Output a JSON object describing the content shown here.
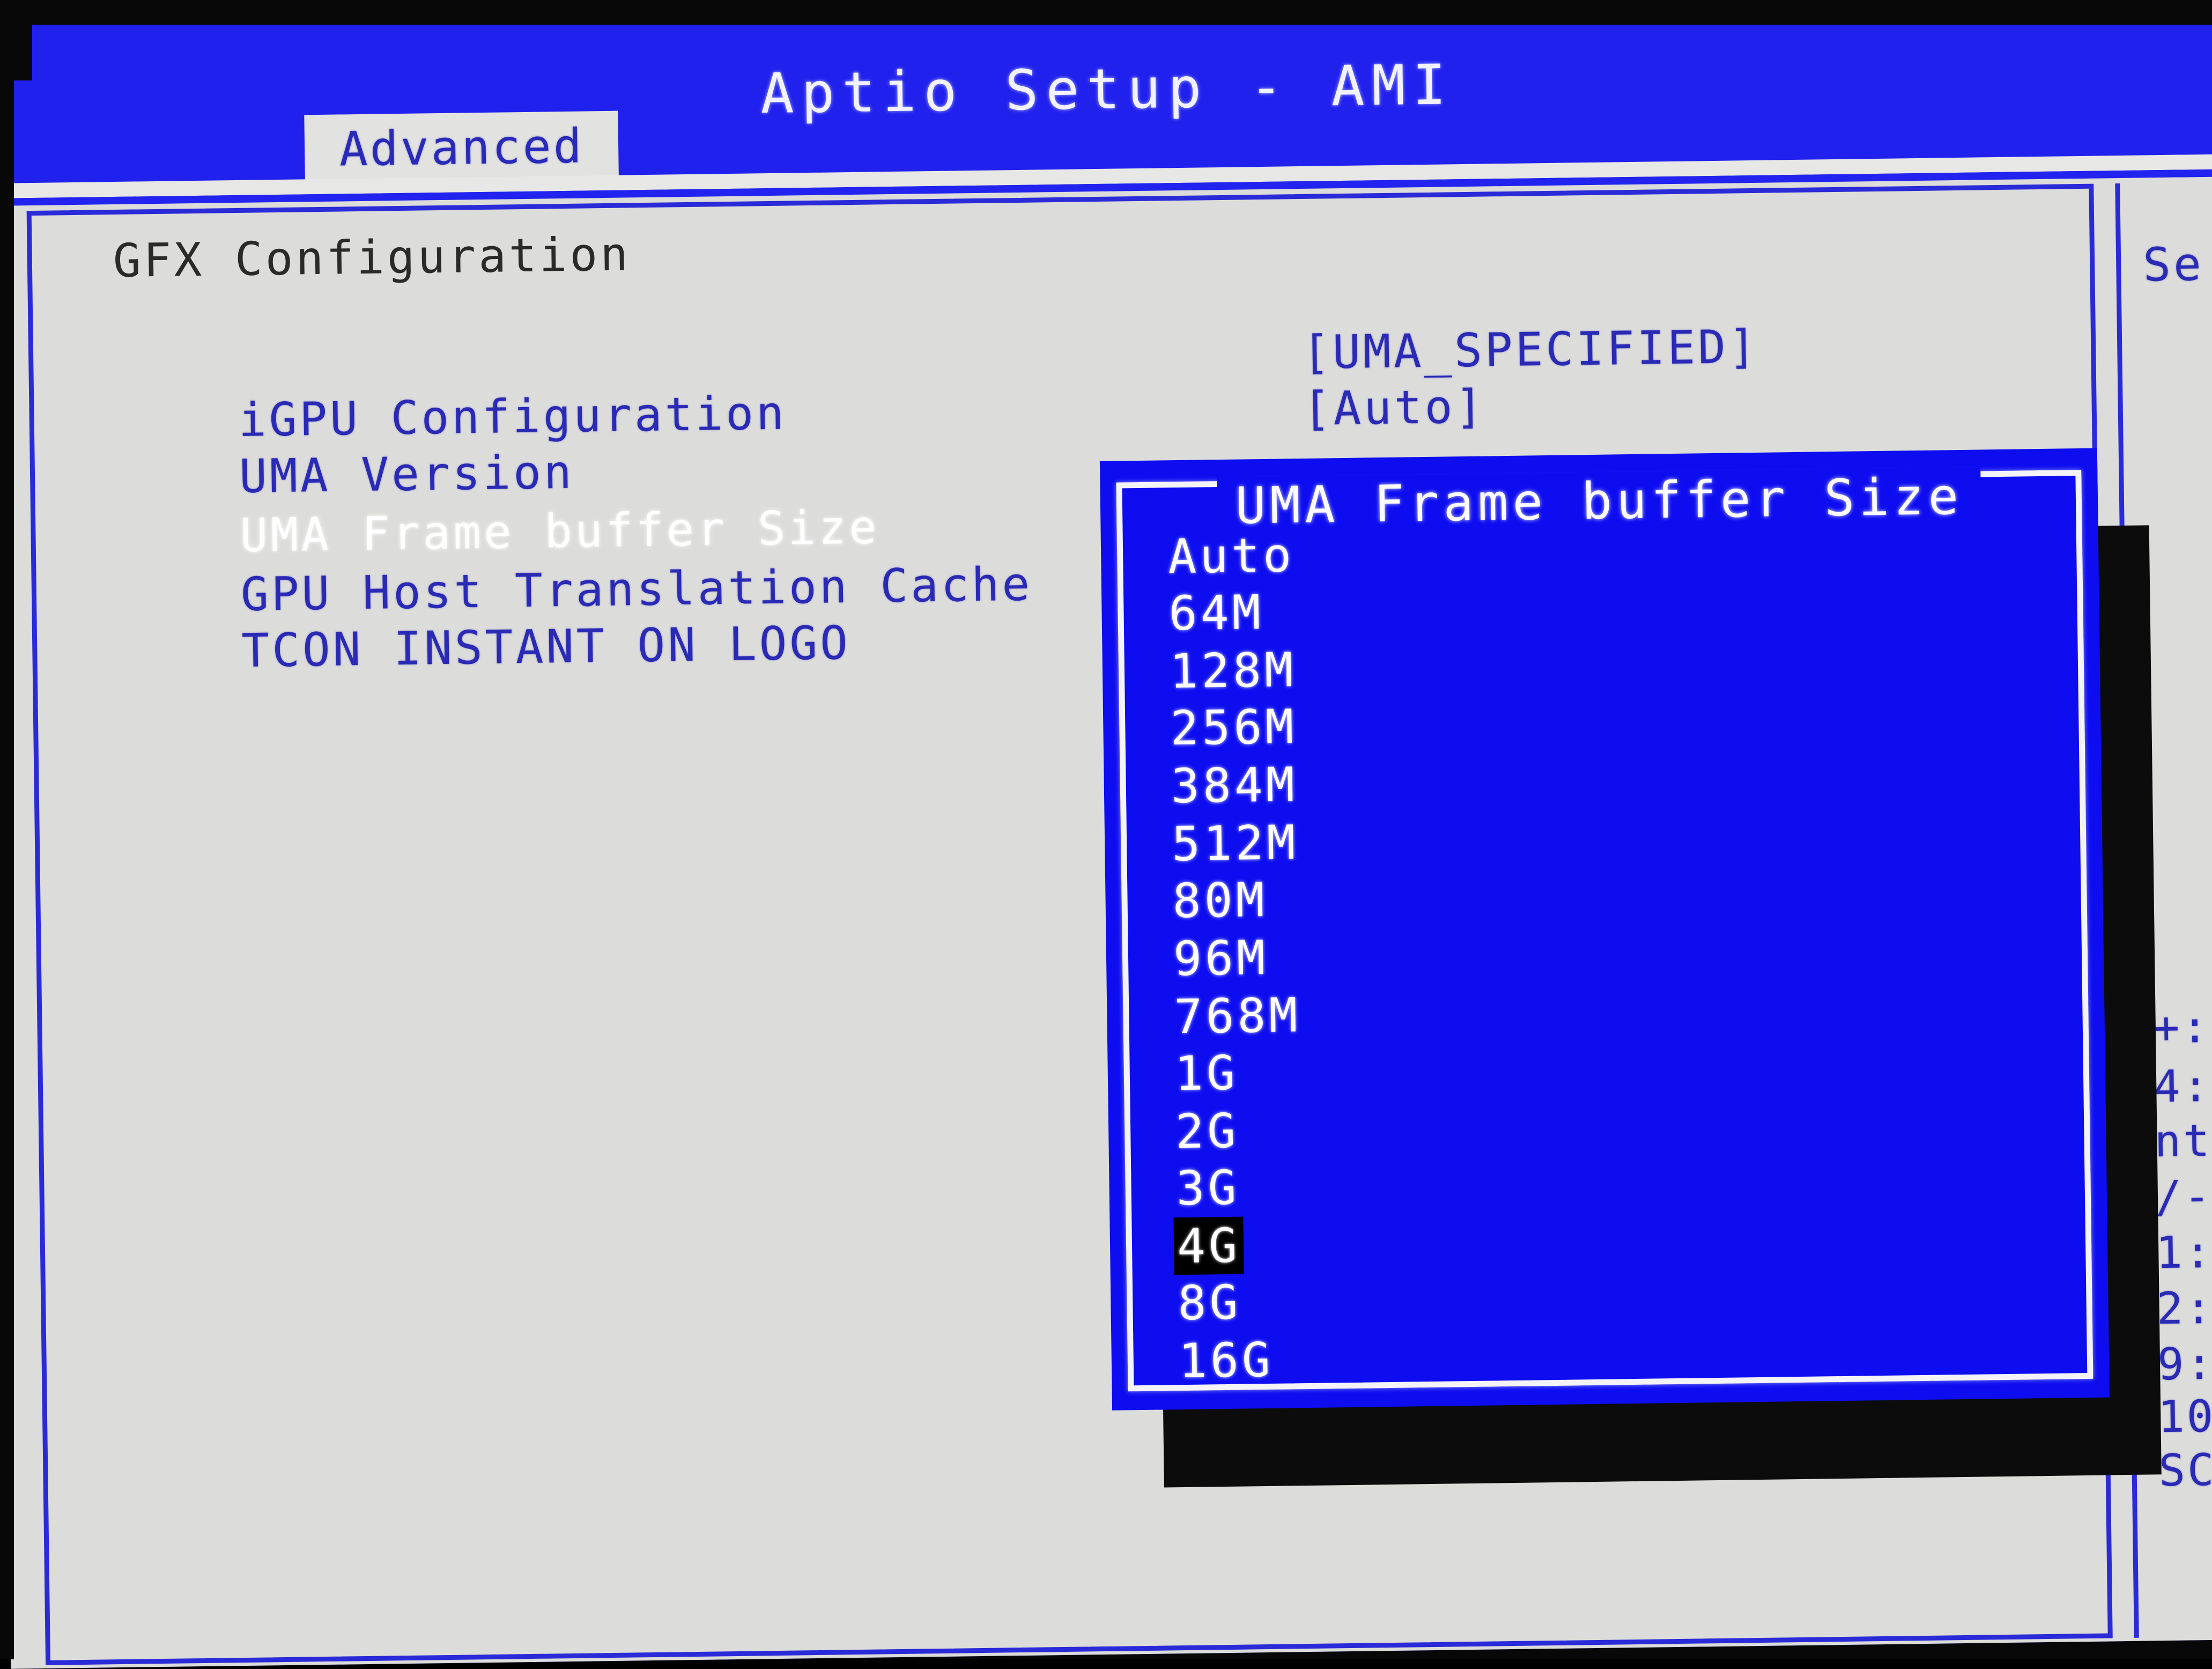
{
  "header": {
    "title": "Aptio Setup - AMI",
    "tab": "Advanced"
  },
  "section": {
    "title": "GFX Configuration"
  },
  "settings": [
    {
      "label": "iGPU Configuration",
      "value": "[UMA_SPECIFIED]",
      "selected": false
    },
    {
      "label": "UMA Version",
      "value": "[Auto]",
      "selected": false
    },
    {
      "label": "UMA Frame buffer Size",
      "value": "",
      "selected": true
    },
    {
      "label": "GPU Host Translation Cache",
      "value": "",
      "selected": false
    },
    {
      "label": "TCON INSTANT ON LOGO",
      "value": "",
      "selected": false
    }
  ],
  "dialog": {
    "title": "UMA Frame buffer Size",
    "selected": "4G",
    "options": [
      "Auto",
      "64M",
      "128M",
      "256M",
      "384M",
      "512M",
      "80M",
      "96M",
      "768M",
      "1G",
      "2G",
      "3G",
      "4G",
      "8G",
      "16G"
    ]
  },
  "help": {
    "heading": "Se",
    "lines": [
      "+:",
      "4:",
      "nt",
      "/-",
      "1:",
      "2:",
      "9:",
      "10",
      "SC"
    ]
  },
  "colors": {
    "header_blue": "#2121ee",
    "dialog_blue": "#0d0df0",
    "panel_gray": "#dcdcda",
    "label_blue": "#2a2ab4",
    "highlight_bg": "#000000",
    "text_white": "#fcfcff"
  }
}
